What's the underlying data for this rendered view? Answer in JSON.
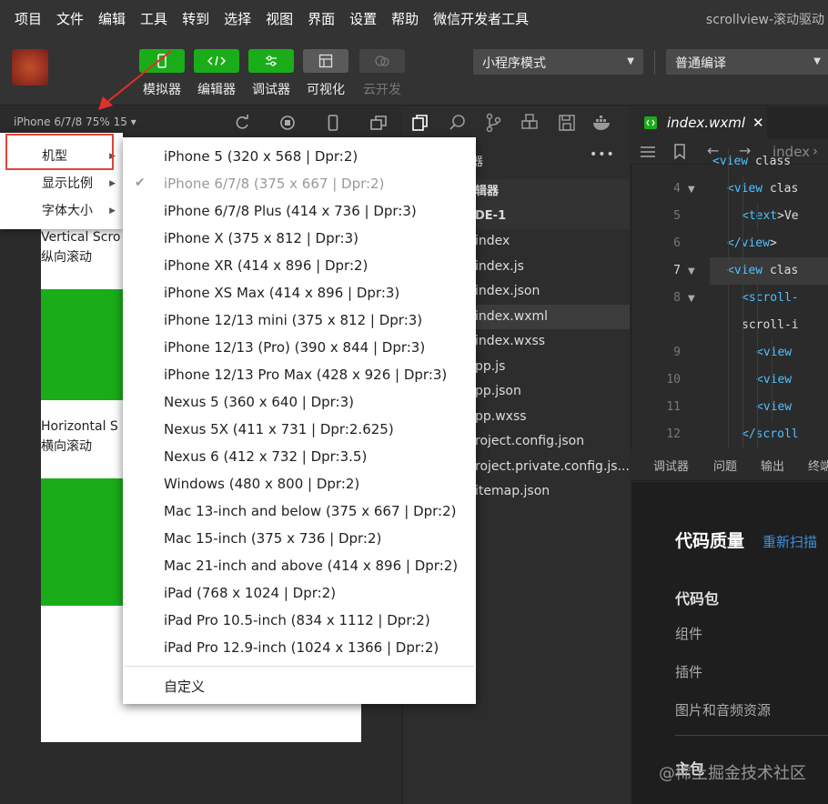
{
  "menubar": {
    "items": [
      "项目",
      "文件",
      "编辑",
      "工具",
      "转到",
      "选择",
      "视图",
      "界面",
      "设置",
      "帮助",
      "微信开发者工具"
    ],
    "window_title": "scrollview-滚动驱动"
  },
  "toolbar": {
    "buttons": [
      {
        "label": "模拟器",
        "icon": "phone-icon"
      },
      {
        "label": "编辑器",
        "icon": "code-icon"
      },
      {
        "label": "调试器",
        "icon": "sliders-icon"
      },
      {
        "label": "可视化",
        "icon": "layout-icon"
      },
      {
        "label": "云开发",
        "icon": "cloud-icon"
      }
    ],
    "mode_select": "小程序模式",
    "compile_select": "普通编译"
  },
  "simulator": {
    "device_label": "iPhone 6/7/8 75% 15 ▾",
    "vertical_title": "Vertical Scro",
    "vertical_sub": "纵向滚动",
    "horizontal_title": "Horizontal S",
    "horizontal_sub": "横向滚动"
  },
  "context_menu": {
    "items": [
      {
        "label": "机型",
        "arrow": "▶"
      },
      {
        "label": "显示比例",
        "arrow": "▶"
      },
      {
        "label": "字体大小",
        "arrow": "▶"
      }
    ]
  },
  "submenu": {
    "items": [
      "iPhone 5  (320 x 568 | Dpr:2)",
      "iPhone 6/7/8  (375 x 667 | Dpr:2)",
      "iPhone 6/7/8 Plus  (414 x 736 | Dpr:3)",
      "iPhone X  (375 x 812 | Dpr:3)",
      "iPhone XR  (414 x 896 | Dpr:2)",
      "iPhone XS Max  (414 x 896 | Dpr:3)",
      "iPhone 12/13 mini  (375 x 812 | Dpr:3)",
      "iPhone 12/13 (Pro)  (390 x 844 | Dpr:3)",
      "iPhone 12/13 Pro Max  (428 x 926 | Dpr:3)",
      "Nexus 5  (360 x 640 | Dpr:3)",
      "Nexus 5X  (411 x 731 | Dpr:2.625)",
      "Nexus 6  (412 x 732 | Dpr:3.5)",
      "Windows  (480 x 800 | Dpr:2)",
      "Mac 13-inch and below  (375 x 667 | Dpr:2)",
      "Mac 15-inch  (375 x 736 | Dpr:2)",
      "Mac 21-inch and above  (414 x 896 | Dpr:2)",
      "iPad  (768 x 1024 | Dpr:2)",
      "iPad Pro 10.5-inch  (834 x 1112 | Dpr:2)",
      "iPad Pro 12.9-inch  (1024 x 1366 | Dpr:2)"
    ],
    "selected_index": 1,
    "check_mark": "✔",
    "custom": "自定义"
  },
  "filetree": {
    "more": "•••",
    "header_partial": "理器",
    "section": "辑器",
    "project": "DE-1",
    "files": [
      "index",
      "index.js",
      "index.json",
      "index.wxml",
      "index.wxss",
      "pp.js",
      "pp.json",
      "pp.wxss",
      "roject.config.json",
      "roject.private.config.js...",
      "itemap.json"
    ],
    "selected_file": "index.wxml"
  },
  "editor": {
    "active_tab": "index.wxml",
    "close": "✕",
    "breadcrumb": "index",
    "lines": [
      {
        "n": "",
        "code": "<view class"
      },
      {
        "n": "4",
        "code": "<view clas"
      },
      {
        "n": "5",
        "code": "<text>Ve"
      },
      {
        "n": "6",
        "code": "</view>"
      },
      {
        "n": "7",
        "code": "<view clas"
      },
      {
        "n": "8",
        "code": "<scroll-"
      },
      {
        "n": "",
        "code": "scroll-i"
      },
      {
        "n": "9",
        "code": "<view"
      },
      {
        "n": "10",
        "code": "<view"
      },
      {
        "n": "11",
        "code": "<view"
      },
      {
        "n": "12",
        "code": "</scroll"
      }
    ]
  },
  "panel": {
    "tabs": [
      "调试器",
      "问题",
      "输出",
      "终端"
    ],
    "code_quality": "代码质量",
    "rescan": "重新扫描",
    "package": "代码包",
    "items": [
      "组件",
      "插件",
      "图片和音频资源"
    ],
    "main_package": "主包"
  },
  "watermark": "@稀土掘金技术社区"
}
